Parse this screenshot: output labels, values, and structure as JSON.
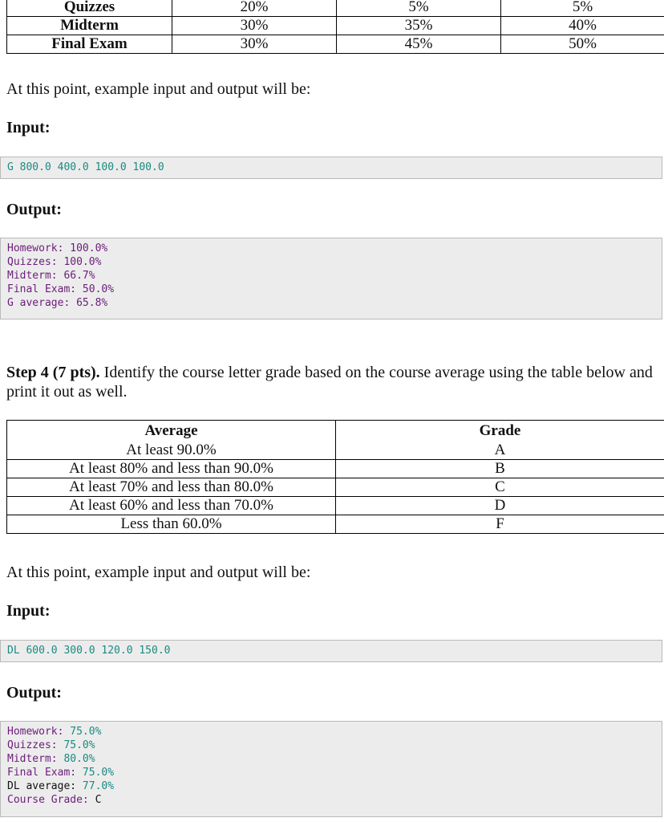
{
  "weights_table": {
    "rows": [
      {
        "label": "Quizzes",
        "c1": "20%",
        "c2": "5%",
        "c3": "5%"
      },
      {
        "label": "Midterm",
        "c1": "30%",
        "c2": "35%",
        "c3": "40%"
      },
      {
        "label": "Final Exam",
        "c1": "30%",
        "c2": "45%",
        "c3": "50%"
      }
    ]
  },
  "section1": {
    "intro": "At this point, example input and output will be:",
    "input_heading": "Input:",
    "input_code": "G 800.0 400.0 100.0 100.0",
    "output_heading": "Output:",
    "output_lines": [
      {
        "key": "Homework:",
        "val": "100.0%"
      },
      {
        "key": "Quizzes:",
        "val": "100.0%"
      },
      {
        "key": "Midterm:",
        "val": "66.7%"
      },
      {
        "key": "Final Exam:",
        "val": "50.0%"
      },
      {
        "key": "G average:",
        "val": "65.8%"
      }
    ]
  },
  "step4": {
    "title": "Step 4 (7 pts).",
    "text": " Identify the course letter grade based on the course average using the table below and print it out as well."
  },
  "grade_table": {
    "headers": [
      "Average",
      "Grade"
    ],
    "rows": [
      {
        "average": "At least 90.0%",
        "grade": "A"
      },
      {
        "average": "At least 80% and less than 90.0%",
        "grade": "B"
      },
      {
        "average": "At least 70% and less than 80.0%",
        "grade": "C"
      },
      {
        "average": "At least 60% and less than 70.0%",
        "grade": "D"
      },
      {
        "average": "Less than 60.0%",
        "grade": "F"
      }
    ]
  },
  "section2": {
    "intro": "At this point, example input and output will be:",
    "input_heading": "Input:",
    "input_code": "DL 600.0 300.0 120.0 150.0",
    "output_heading": "Output:",
    "output_lines": [
      {
        "key": "Homework:",
        "val": "75.0%"
      },
      {
        "key": "Quizzes:",
        "val": "75.0%"
      },
      {
        "key": "Midterm:",
        "val": "80.0%"
      },
      {
        "key": "Final Exam:",
        "val": "75.0%"
      },
      {
        "key": "DL average:",
        "val": "77.0%"
      },
      {
        "key": "Course Grade:",
        "val": "C"
      }
    ]
  }
}
